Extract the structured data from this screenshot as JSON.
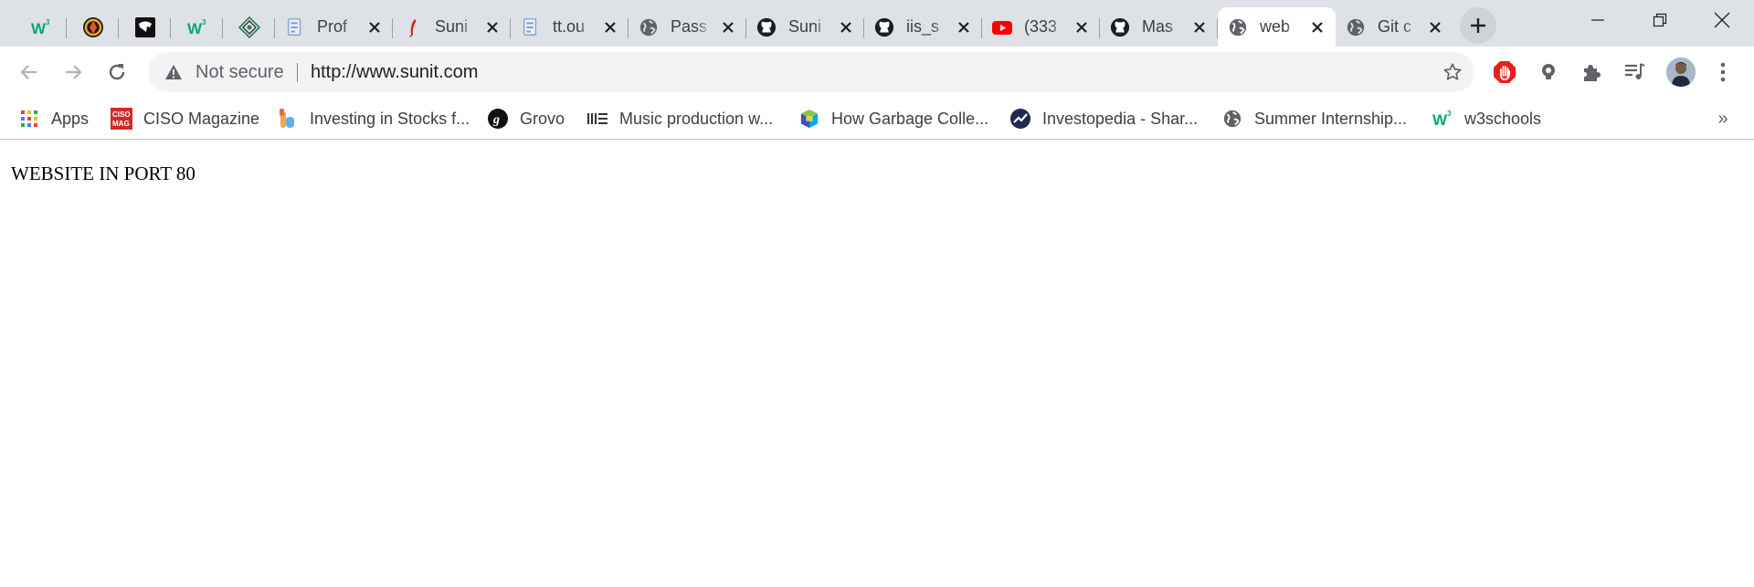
{
  "tabs": [
    {
      "kind": "pinned",
      "icon": "w3schools-icon",
      "title": ""
    },
    {
      "kind": "pinned",
      "icon": "orange-circle-logo-icon",
      "title": ""
    },
    {
      "kind": "pinned",
      "icon": "black-square-logo-icon",
      "title": ""
    },
    {
      "kind": "pinned",
      "icon": "w3schools-icon",
      "title": ""
    },
    {
      "kind": "pinned",
      "icon": "diamond-logo-icon",
      "title": ""
    },
    {
      "kind": "normal",
      "icon": "document-icon",
      "title": "Prof"
    },
    {
      "kind": "normal",
      "icon": "red-feather-icon",
      "title": "Suni"
    },
    {
      "kind": "normal",
      "icon": "document-icon",
      "title": "tt.ou"
    },
    {
      "kind": "normal",
      "icon": "globe-icon",
      "title": "Pass"
    },
    {
      "kind": "normal",
      "icon": "github-icon",
      "title": "Suni"
    },
    {
      "kind": "normal",
      "icon": "github-icon",
      "title": "iis_s"
    },
    {
      "kind": "normal",
      "icon": "youtube-icon",
      "title": "(333"
    },
    {
      "kind": "normal",
      "icon": "github-icon",
      "title": "Mas"
    },
    {
      "kind": "active",
      "icon": "globe-icon",
      "title": "web"
    },
    {
      "kind": "normal",
      "icon": "globe-icon",
      "title": "Git c"
    }
  ],
  "window_controls": {
    "minimize": "minimize-icon",
    "restore": "restore-icon",
    "close": "close-icon"
  },
  "omnibox": {
    "security_label": "Not secure",
    "url": "http://www.sunit.com"
  },
  "bookmarks": [
    {
      "label": "Apps",
      "icon": "apps-grid-icon"
    },
    {
      "label": "CISO Magazine",
      "icon": "ciso-mag-icon"
    },
    {
      "label": "Investing in Stocks f...",
      "icon": "investing-icon"
    },
    {
      "label": "Grovo",
      "icon": "grovo-icon"
    },
    {
      "label": "Music production w...",
      "icon": "music-bars-icon"
    },
    {
      "label": "How Garbage Colle...",
      "icon": "colorful-cube-icon"
    },
    {
      "label": "Investopedia - Shar...",
      "icon": "investopedia-icon"
    },
    {
      "label": "Summer Internship...",
      "icon": "globe-icon"
    },
    {
      "label": "w3schools",
      "icon": "w3schools-icon"
    }
  ],
  "bookmarks_more": "»",
  "page": {
    "text": "WEBSITE IN PORT 80"
  },
  "colors": {
    "tabstrip_bg": "#dee1e6",
    "omnibox_bg": "#f1f3f4",
    "ext_red": "#e8201c",
    "w3_green": "#04aa6d"
  }
}
